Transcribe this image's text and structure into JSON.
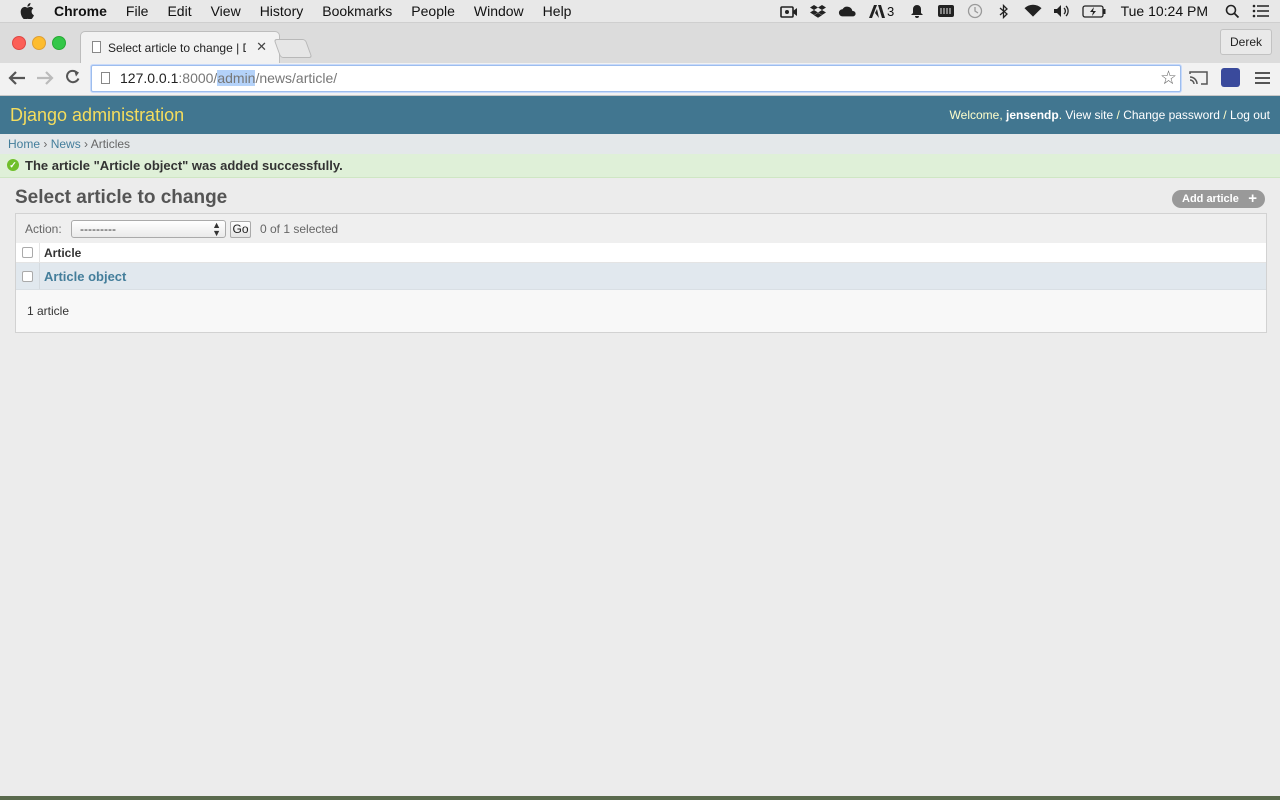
{
  "menubar": {
    "items": [
      "Chrome",
      "File",
      "Edit",
      "View",
      "History",
      "Bookmarks",
      "People",
      "Window",
      "Help"
    ],
    "status_icons": [
      "video-icon",
      "dropbox-icon",
      "cloud-icon",
      "adobe-icon",
      "notification-bell-icon",
      "keyboard-icon",
      "time-machine-icon",
      "bluetooth-icon",
      "wifi-icon",
      "volume-icon",
      "battery-icon",
      "spotlight-icon",
      "notification-center-icon"
    ],
    "adobe_badge": "3",
    "clock": "Tue 10:24 PM"
  },
  "browser": {
    "tab_title": "Select article to change | D",
    "profile": "Derek",
    "url_host": "127.0.0.1",
    "url_port": ":8000/",
    "url_selected": "admin",
    "url_rest": "/news/article/"
  },
  "admin": {
    "brand": "Django administration",
    "welcome": "Welcome, ",
    "username": "jensendp",
    "view_site": "View site",
    "change_password": "Change password",
    "logout": "Log out",
    "sep": " / ",
    "breadcrumbs": [
      "Home",
      "News",
      "Articles"
    ],
    "crumb_sep": " › ",
    "message": "The article \"Article object\" was added successfully.",
    "title": "Select article to change",
    "add_button": "Add article",
    "action_label": "Action:",
    "action_value": "---------",
    "go_label": "Go",
    "selected_count": "0 of 1 selected",
    "column_header": "Article",
    "rows": [
      "Article object"
    ],
    "paginator": "1 article"
  },
  "colors": {
    "header_bg": "#417690",
    "brand_yellow": "#f5dd5d",
    "link_blue": "#447e9b",
    "success_bg": "#dff0d8"
  }
}
